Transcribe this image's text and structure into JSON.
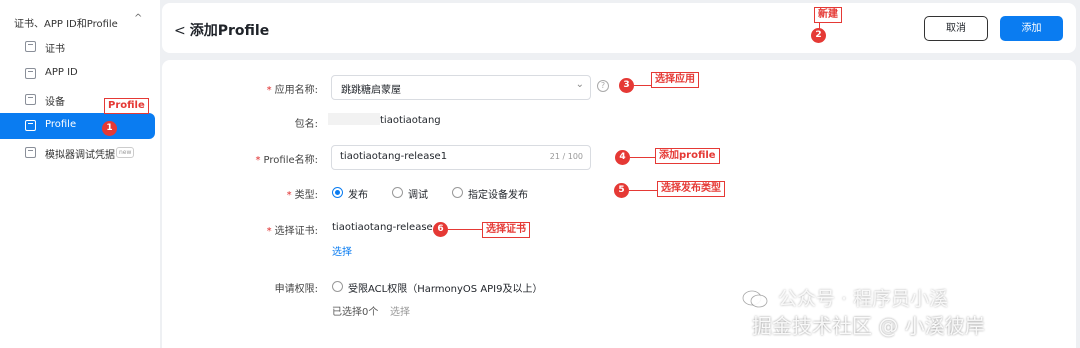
{
  "sidebar": {
    "group_label": "证书、APP ID和Profile",
    "caret": "^",
    "items": [
      {
        "label": "证书"
      },
      {
        "label": "APP ID"
      },
      {
        "label": "设备"
      },
      {
        "label": "Profile"
      },
      {
        "label": "模拟器调试凭据",
        "badge": "new"
      }
    ]
  },
  "header": {
    "back_arrow": "<",
    "title": "添加Profile",
    "cancel_label": "取消",
    "add_label": "添加"
  },
  "form": {
    "app_name_label": "应用名称:",
    "app_name_value": "跳跳糖启蒙屋",
    "help_glyph": "?",
    "package_label": "包名:",
    "package_value": "tiaotiaotang",
    "profile_name_label": "Profile名称:",
    "profile_name_value": "tiaotiaotang-release1",
    "profile_name_count": "21 / 100",
    "type_label": "类型:",
    "type_options": [
      "发布",
      "调试",
      "指定设备发布"
    ],
    "cert_label": "选择证书:",
    "cert_value": "tiaotiaotang-release",
    "cert_remove": "×",
    "cert_select_link": "选择",
    "perm_label": "申请权限:",
    "perm_option": "受限ACL权限（HarmonyOS API9及以上）",
    "perm_selected": "已选择0个",
    "perm_select_link": "选择",
    "required_mark": "*"
  },
  "annotations": [
    {
      "num": "1",
      "text": "Profile"
    },
    {
      "num": "2",
      "text": "新建"
    },
    {
      "num": "3",
      "text": "选择应用"
    },
    {
      "num": "4",
      "text": "添加profile"
    },
    {
      "num": "5",
      "text": "选择发布类型"
    },
    {
      "num": "6",
      "text": "选择证书"
    }
  ],
  "watermark": {
    "line1": "公众号 · 程序员小溪",
    "line2": "掘金技术社区 @ 小溪彼岸"
  },
  "colors": {
    "accent": "#0a7cf1",
    "annotation": "#e53935",
    "required": "#e02c2c"
  }
}
